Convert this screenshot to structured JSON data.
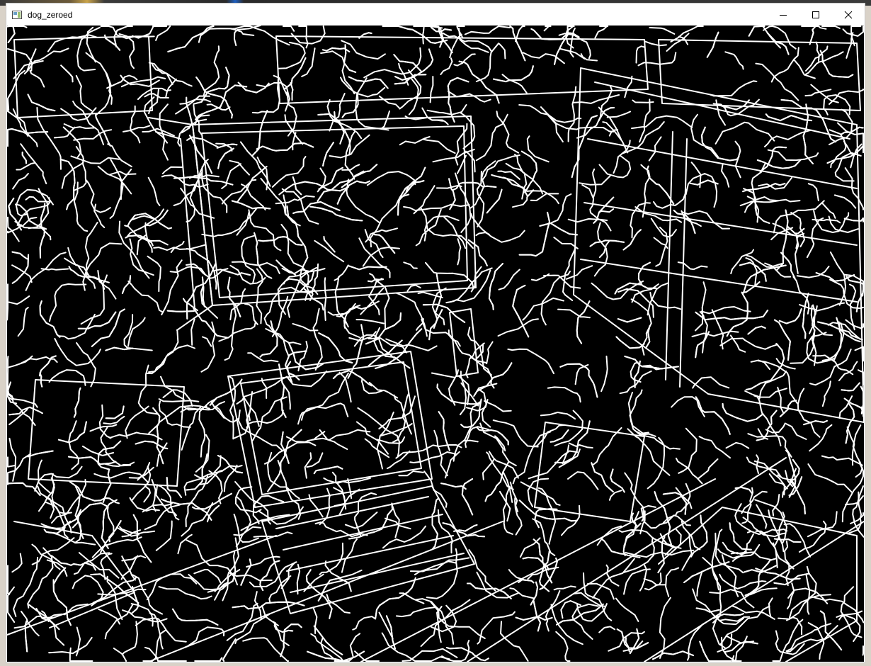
{
  "window": {
    "title": "dog_zeroed",
    "app_icon": "image-window-icon",
    "controls": {
      "minimize": "minimize-icon",
      "maximize": "maximize-icon",
      "close": "close-icon"
    }
  },
  "image": {
    "description_icon": "edge-map-image",
    "background_color": "#000000",
    "edge_color": "#ffffff"
  }
}
